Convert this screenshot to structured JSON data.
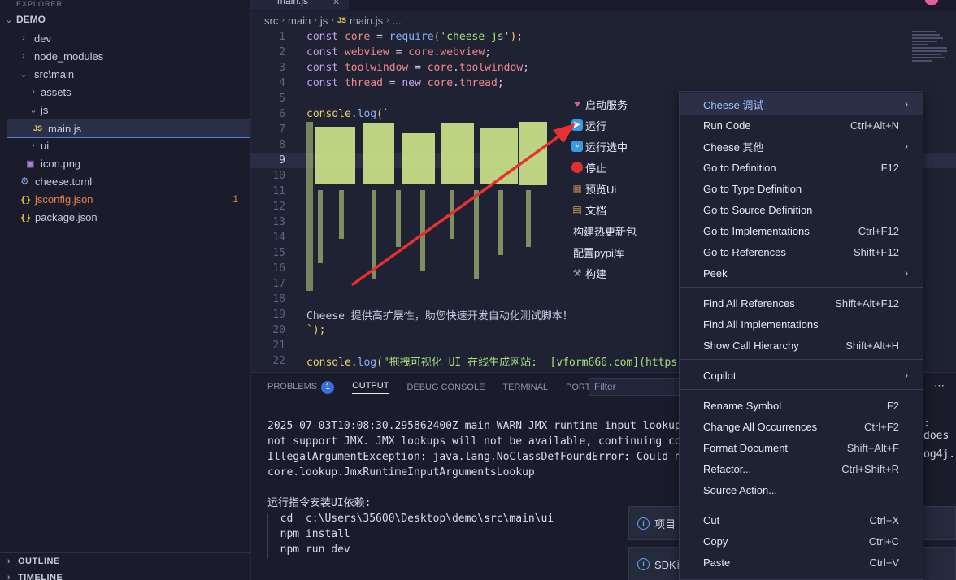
{
  "explorer": {
    "header": "EXPLORER",
    "root": "DEMO",
    "items": [
      {
        "label": "dev"
      },
      {
        "label": "node_modules"
      },
      {
        "label": "src\\main"
      },
      {
        "label": "assets"
      },
      {
        "label": "js"
      },
      {
        "label": "main.js"
      },
      {
        "label": "ui"
      },
      {
        "label": "icon.png"
      },
      {
        "label": "cheese.toml"
      },
      {
        "label": "jsconfig.json",
        "badge": "1"
      },
      {
        "label": "package.json"
      }
    ],
    "outline": "OUTLINE",
    "timeline": "TIMELINE"
  },
  "tab": {
    "label": "main.js",
    "close": "✕"
  },
  "breadcrumb": [
    "src",
    "main",
    "js",
    "main.js",
    "..."
  ],
  "editor": {
    "line_numbers": [
      "1",
      "2",
      "3",
      "4",
      "5",
      "6",
      "7",
      "8",
      "9",
      "10",
      "11",
      "12",
      "13",
      "14",
      "15",
      "16",
      "17",
      "18",
      "19",
      "20",
      "21",
      "22"
    ],
    "lines": {
      "l1": {
        "kw": "const ",
        "var": "core",
        "op": " = ",
        "fn": "require",
        "p1": "(",
        "str": "'cheese-js'",
        "p2": ");"
      },
      "l2": {
        "kw": "const ",
        "var": "webview",
        "op": " = ",
        "obj": "core",
        "dot": ".",
        "prop": "webview",
        "end": ";"
      },
      "l3": {
        "kw": "const ",
        "var": "toolwindow",
        "op": " = ",
        "obj": "core",
        "dot": ".",
        "prop": "toolwindow",
        "end": ";"
      },
      "l4": {
        "kw": "const ",
        "var": "thread",
        "op": " = ",
        "kw2": "new ",
        "obj": "core",
        "dot": ".",
        "prop": "thread",
        "end": ";"
      },
      "l6": {
        "obj": "console",
        "dot": ".",
        "fn": "log",
        "p1": "(",
        "tick": "`"
      },
      "l19": "Cheese 提供高扩展性，助您快速开发自动化测试脚本！",
      "l20": {
        "tick": "`",
        "end": ");"
      },
      "l22": {
        "obj": "console",
        "dot": ".",
        "fn": "log",
        "p1": "(",
        "str": "\"拖拽可视化 UI 在线生成网站:  [vform666.com](https"
      }
    }
  },
  "panel": {
    "tabs": [
      "PROBLEMS",
      "OUTPUT",
      "DEBUG CONSOLE",
      "TERMINAL",
      "PORTS"
    ],
    "problems_count": "1",
    "filter_placeholder": "Filter",
    "more": "⋯",
    "output": [
      "2025-07-03T10:08:30.295862400Z main WARN JMX runtime input lookup",
      "not support JMX. JMX lookups will not be available, continuing con",
      "IllegalArgumentException: java.lang.NoClassDefFoundError: Could no",
      "core.lookup.JmxRuntimeInputArgumentsLookup",
      "",
      "运行指令安装UI依赖:",
      "  cd  c:\\Users\\35600\\Desktop\\demo\\src\\main\\ui",
      "  npm install",
      "  npm run dev"
    ],
    "output_right": [
      ": does",
      "og4j."
    ]
  },
  "notifications": [
    {
      "text": "项目"
    },
    {
      "text": "SDK已"
    }
  ],
  "cheese_submenu": [
    {
      "icon": "heart-icon",
      "label": "启动服务",
      "color": "#e0609a",
      "glyph": "♥"
    },
    {
      "icon": "play-icon",
      "label": "运行",
      "color": "#3a9ae0",
      "glyph": "▶"
    },
    {
      "icon": "fast-forward-icon",
      "label": "运行选中",
      "color": "#3a9ae0",
      "glyph": "⏩"
    },
    {
      "icon": "stop-icon",
      "label": "停止",
      "color": "#e03030",
      "glyph": "●"
    },
    {
      "icon": "abacus-icon",
      "label": "预览Ui",
      "color": "#b08050",
      "glyph": "▦"
    },
    {
      "icon": "scroll-icon",
      "label": "文档",
      "color": "#d8a860",
      "glyph": "▤"
    },
    {
      "icon": "",
      "label": "构建热更新包",
      "color": "",
      "glyph": ""
    },
    {
      "icon": "",
      "label": "配置pypi库",
      "color": "",
      "glyph": ""
    },
    {
      "icon": "tools-icon",
      "label": "构建",
      "color": "#a0a8b8",
      "glyph": "⚒"
    }
  ],
  "context_menu": [
    {
      "label": "Cheese 调试",
      "key": "",
      "submenu": true,
      "active": true
    },
    {
      "label": "Run Code",
      "key": "Ctrl+Alt+N"
    },
    {
      "label": "Cheese 其他",
      "key": "",
      "submenu": true
    },
    {
      "label": "Go to Definition",
      "key": "F12"
    },
    {
      "label": "Go to Type Definition",
      "key": ""
    },
    {
      "label": "Go to Source Definition",
      "key": ""
    },
    {
      "label": "Go to Implementations",
      "key": "Ctrl+F12"
    },
    {
      "label": "Go to References",
      "key": "Shift+F12"
    },
    {
      "label": "Peek",
      "key": "",
      "submenu": true
    },
    {
      "label": "Find All References",
      "key": "Shift+Alt+F12"
    },
    {
      "label": "Find All Implementations",
      "key": ""
    },
    {
      "label": "Show Call Hierarchy",
      "key": "Shift+Alt+H"
    },
    {
      "label": "Copilot",
      "key": "",
      "submenu": true
    },
    {
      "label": "Rename Symbol",
      "key": "F2"
    },
    {
      "label": "Change All Occurrences",
      "key": "Ctrl+F2"
    },
    {
      "label": "Format Document",
      "key": "Shift+Alt+F"
    },
    {
      "label": "Refactor...",
      "key": "Ctrl+Shift+R"
    },
    {
      "label": "Source Action...",
      "key": ""
    },
    {
      "label": "Cut",
      "key": "Ctrl+X"
    },
    {
      "label": "Copy",
      "key": "Ctrl+C"
    },
    {
      "label": "Paste",
      "key": "Ctrl+V"
    }
  ],
  "colors": {
    "accent": "#3a6fd8",
    "arrow": "#e83030",
    "ascii_art": "#cde88a"
  }
}
